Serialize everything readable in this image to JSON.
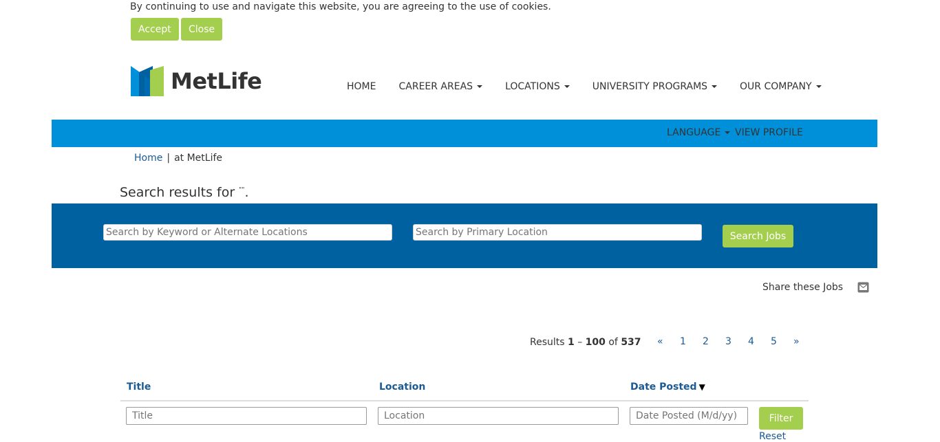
{
  "cookie_banner": {
    "message": "By continuing to use and navigate this website, you are agreeing to the use of cookies.",
    "accept_label": "Accept",
    "close_label": "Close"
  },
  "brand": {
    "logo_text": "MetLife",
    "colors": {
      "blue": "#0090da",
      "dark_blue": "#0061a0",
      "green": "#a4ce4e"
    }
  },
  "main_nav": [
    {
      "label": "HOME",
      "has_dropdown": false
    },
    {
      "label": "CAREER AREAS",
      "has_dropdown": true
    },
    {
      "label": "LOCATIONS",
      "has_dropdown": true
    },
    {
      "label": "UNIVERSITY PROGRAMS",
      "has_dropdown": true
    },
    {
      "label": "OUR COMPANY",
      "has_dropdown": true
    }
  ],
  "utility_bar": {
    "language_label": "LANGUAGE",
    "view_profile_label": "VIEW PROFILE"
  },
  "breadcrumb": {
    "home_label": "Home",
    "separator": "|",
    "current": "at MetLife"
  },
  "search": {
    "title_prefix": "Search results for ",
    "query_display": "\"\"",
    "title_suffix": ".",
    "keyword_placeholder": "Search by Keyword or Alternate Locations",
    "location_placeholder": "Search by Primary Location",
    "button_label": "Search Jobs"
  },
  "share": {
    "label": "Share these Jobs",
    "icon": "envelope-icon"
  },
  "results": {
    "prefix": "Results ",
    "start": "1",
    "dash": " – ",
    "end": "100",
    "of": " of ",
    "total": "537"
  },
  "pagination": {
    "prev": "«",
    "pages": [
      "1",
      "2",
      "3",
      "4",
      "5"
    ],
    "next": "»"
  },
  "table": {
    "columns": [
      "Title",
      "Location",
      "Date Posted"
    ],
    "sort_indicator": "▼",
    "filters": {
      "title_placeholder": "Title",
      "location_placeholder": "Location",
      "date_placeholder": "Date Posted (M/d/yy)"
    },
    "filter_button": "Filter",
    "reset_label": "Reset"
  }
}
